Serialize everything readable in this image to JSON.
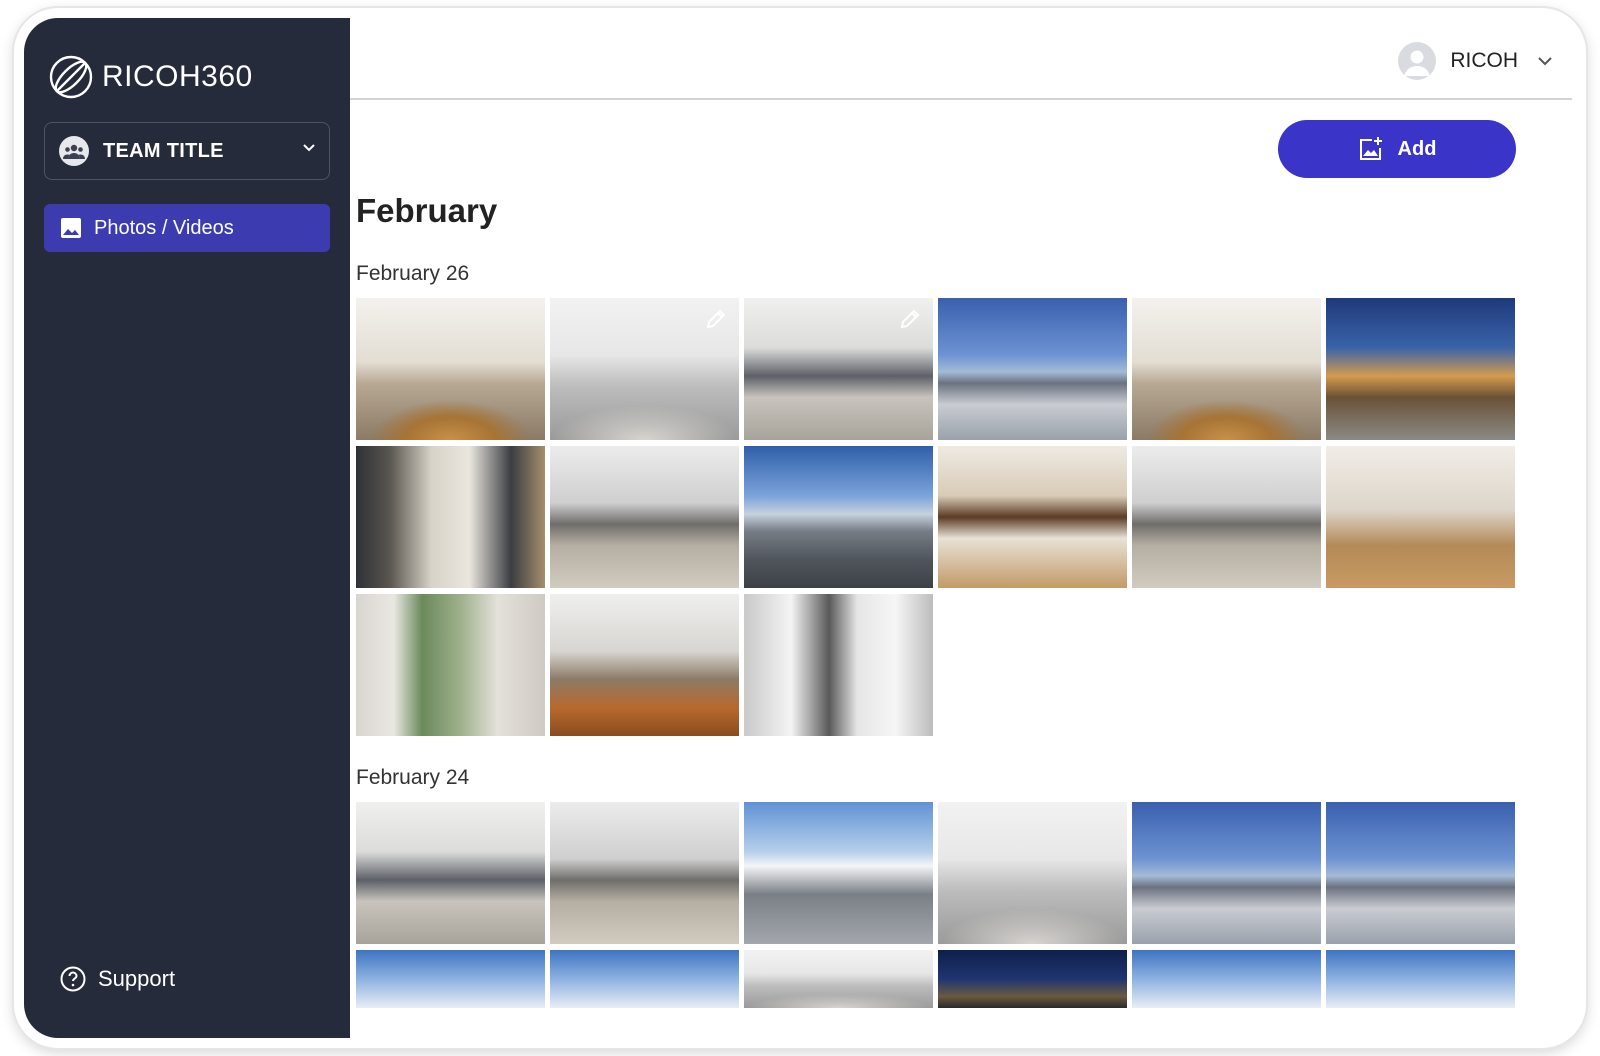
{
  "app": {
    "brand": "RICOH360"
  },
  "sidebar": {
    "team_title": "TEAM TITLE",
    "nav_items": [
      {
        "label": "Photos / Videos",
        "icon": "image-icon",
        "active": true
      }
    ],
    "support_label": "Support"
  },
  "header": {
    "user_name": "RICOH"
  },
  "toolbar": {
    "add_label": "Add"
  },
  "colors": {
    "sidebar_bg": "#252b3a",
    "accent": "#3a34c8",
    "nav_active": "#3d3bb0"
  },
  "main": {
    "month_title": "February",
    "groups": [
      {
        "date_label": "February 26",
        "thumbnails": [
          {
            "scene": "interior"
          },
          {
            "scene": "white",
            "edited": true
          },
          {
            "scene": "loft",
            "edited": true
          },
          {
            "scene": "sky"
          },
          {
            "scene": "interior"
          },
          {
            "scene": "night"
          },
          {
            "scene": "bath"
          },
          {
            "scene": "living"
          },
          {
            "scene": "aerial"
          },
          {
            "scene": "kitchen"
          },
          {
            "scene": "living"
          },
          {
            "scene": "hall"
          },
          {
            "scene": "glass"
          },
          {
            "scene": "wood"
          },
          {
            "scene": "door"
          }
        ]
      },
      {
        "date_label": "February 24",
        "thumbnails": [
          {
            "scene": "loft"
          },
          {
            "scene": "living"
          },
          {
            "scene": "roof"
          },
          {
            "scene": "white"
          },
          {
            "scene": "sky"
          },
          {
            "scene": "sky"
          },
          {
            "scene": "skyClouds"
          },
          {
            "scene": "skyClouds"
          },
          {
            "scene": "white"
          },
          {
            "scene": "cityNight"
          },
          {
            "scene": "skyClouds"
          },
          {
            "scene": "skyClouds"
          }
        ]
      }
    ]
  }
}
